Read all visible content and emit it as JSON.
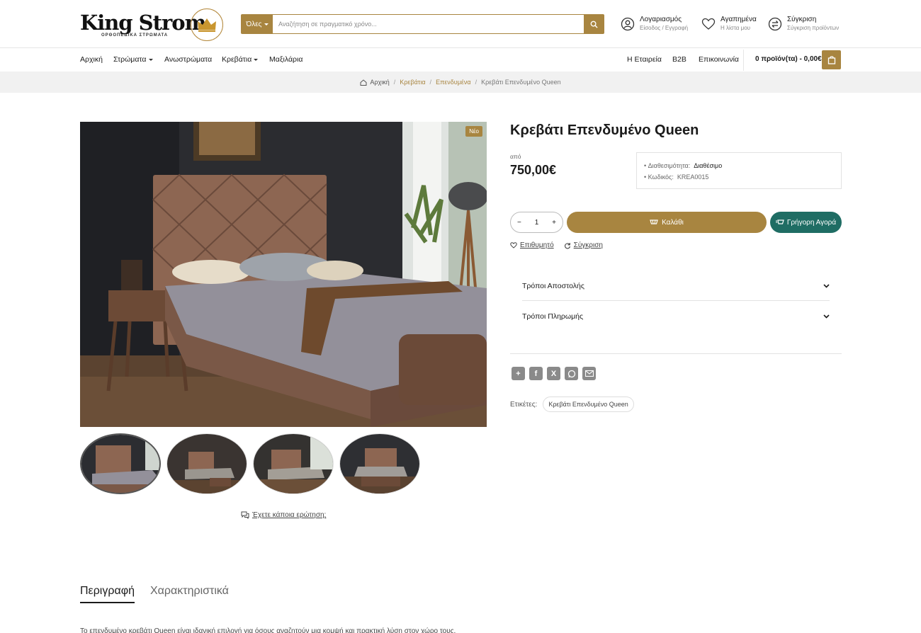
{
  "header": {
    "logo_text": "King Strom",
    "logo_sub": "ΟΡΘΟΠΕΔΙΚΑ ΣΤΡΩΜΑΤΑ",
    "search": {
      "category": "Όλες",
      "placeholder": "Αναζήτηση σε πραγματικό χρόνο..."
    },
    "account": {
      "title": "Λογαριασμός",
      "subtitle": "Είσοδος / Εγγραφή"
    },
    "wishlist": {
      "title": "Αγαπημένα",
      "subtitle": "Η λίστα μου"
    },
    "compare": {
      "title": "Σύγκριση",
      "subtitle": "Σύγκριση προϊόντων"
    }
  },
  "nav": {
    "items": [
      "Αρχική",
      "Στρώματα",
      "Ανωστρώματα",
      "Κρεβάτια",
      "Μαξιλάρια"
    ],
    "right_items": [
      "Η Εταιρεία",
      "B2B",
      "Επικοινωνία"
    ],
    "cart": "0 προϊόν(τα) - 0,00€"
  },
  "breadcrumb": [
    "Αρχική",
    "Κρεβάτια",
    "Επενδυμένα",
    "Κρεβάτι Επενδυμένο Queen"
  ],
  "gallery": {
    "badge": "Νέο",
    "question": "Έχετε κάποια ερώτηση;"
  },
  "product": {
    "title": "Κρεβάτι Επενδυμένο Queen",
    "price_prefix": "από",
    "price": "750,00€",
    "availability_label": "Διαθεσιμότητα:",
    "availability_value": "Διαθέσιμο",
    "code_label": "Κωδικός:",
    "code_value": "KREA0015",
    "quantity": "1",
    "add_to_cart": "Καλάθι",
    "quick_buy": "Γρήγορη Αγορά",
    "wishlist": "Επιθυμητό",
    "compare": "Σύγκριση",
    "accordion": [
      "Τρόποι Αποστολής",
      "Τρόποι Πληρωμής"
    ],
    "tags_label": "Ετικέτες:",
    "tag": "Κρεβάτι Επενδυμένο Queen"
  },
  "tabs": [
    "Περιγραφή",
    "Χαρακτηριστικά"
  ],
  "description_preview": "Το επενδυμένο κρεβάτι Queen είναι ιδανική επιλογή για όσους αναζητούν μια κομψή και πρακτική λύση στον χώρο τους."
}
